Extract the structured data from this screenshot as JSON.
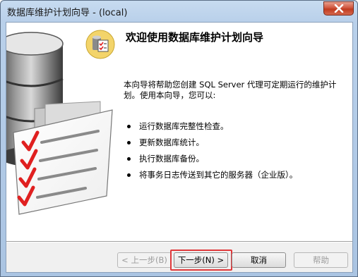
{
  "window": {
    "title": "数据库维护计划向导 - (local)"
  },
  "wizard": {
    "heading": "欢迎使用数据库维护计划向导",
    "intro": "本向导将帮助您创建 SQL Server 代理可定期运行的维护计划。使用本向导，您可以:",
    "bullets": [
      "运行数据库完整性检查。",
      "更新数据库统计。",
      "执行数据库备份。",
      "将事务日志传送到其它的服务器（企业版）。"
    ]
  },
  "buttons": {
    "back": "< 上一步(B)",
    "next": "下一步(N) >",
    "cancel": "取消",
    "help": "帮助"
  },
  "colors": {
    "highlight": "#e0383a",
    "checkmark": "#e02020"
  },
  "icons": {
    "title_close": "close-icon",
    "header": "database-checklist-icon",
    "illustration": "database-checklist-illustration"
  }
}
